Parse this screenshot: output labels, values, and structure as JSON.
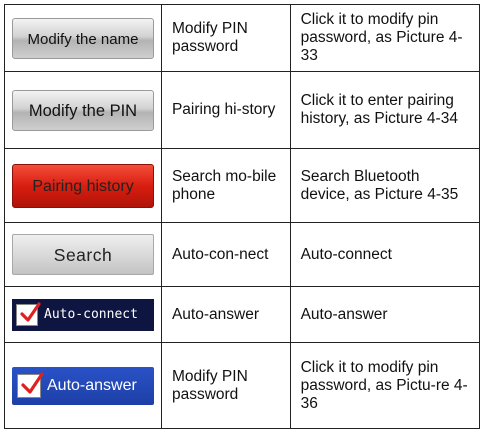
{
  "rows": [
    {
      "button_label": "Modify the name",
      "function": "Modify PIN password",
      "description": "Click it to modify pin password, as Picture 4-33"
    },
    {
      "button_label": "Modify the PIN",
      "function": "Pairing hi-story",
      "description": "Click it to enter pairing history, as Picture 4-34"
    },
    {
      "button_label": "Pairing history",
      "function": "Search mo-bile phone",
      "description": "Search Bluetooth device, as Picture 4-35"
    },
    {
      "button_label": "Search",
      "function": "Auto-con-nect",
      "description": "Auto-connect"
    },
    {
      "button_label": "Auto-connect",
      "function": "Auto-answer",
      "description": "Auto-answer"
    },
    {
      "button_label": "Auto-answer",
      "function": "Modify PIN password",
      "description": "Click it to modify pin password, as Pictu-re 4-36"
    }
  ],
  "colors": {
    "red_button": "#d81e10",
    "dark_button": "#0d1540",
    "blue_button": "#1d3fa6",
    "checkmark": "#e02020"
  },
  "icons": {
    "checkbox": "checked-checkbox-icon"
  }
}
